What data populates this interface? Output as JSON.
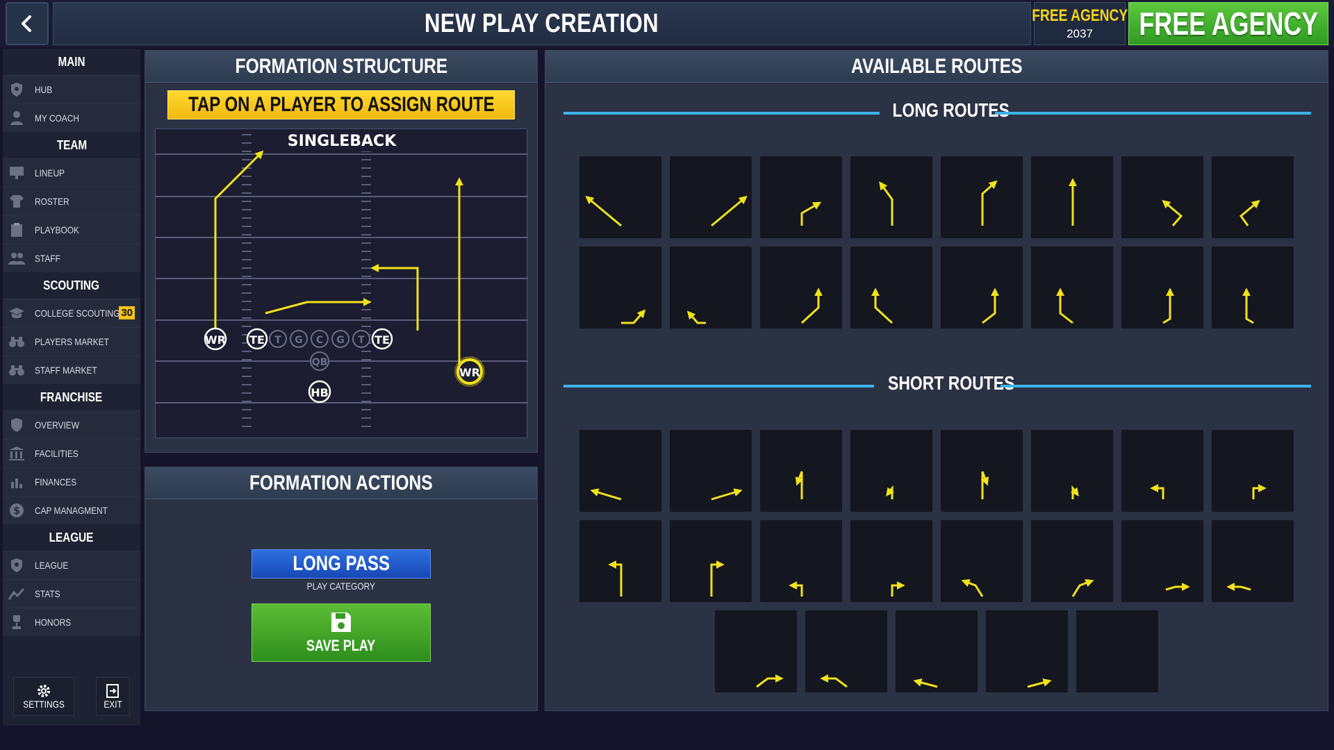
{
  "header": {
    "title": "NEW PLAY CREATION",
    "season_label": "FREE AGENCY",
    "season_year": "2037",
    "phase_button": "FREE AGENCY"
  },
  "sidebar": {
    "sections": [
      {
        "title": "MAIN",
        "items": [
          {
            "label": "HUB",
            "icon": "shield-icon"
          },
          {
            "label": "MY COACH",
            "icon": "person-icon"
          }
        ]
      },
      {
        "title": "TEAM",
        "items": [
          {
            "label": "LINEUP",
            "icon": "board-icon"
          },
          {
            "label": "ROSTER",
            "icon": "jersey-icon"
          },
          {
            "label": "PLAYBOOK",
            "icon": "clipboard-icon"
          },
          {
            "label": "STAFF",
            "icon": "people-icon"
          }
        ]
      },
      {
        "title": "SCOUTING",
        "items": [
          {
            "label": "COLLEGE SCOUTING",
            "icon": "graduation-cap-icon",
            "badge": "30"
          },
          {
            "label": "PLAYERS MARKET",
            "icon": "binoculars-icon"
          },
          {
            "label": "STAFF MARKET",
            "icon": "binoculars-icon"
          }
        ]
      },
      {
        "title": "FRANCHISE",
        "items": [
          {
            "label": "OVERVIEW",
            "icon": "shield-icon"
          },
          {
            "label": "FACILITIES",
            "icon": "building-icon"
          },
          {
            "label": "FINANCES",
            "icon": "bar-chart-icon"
          },
          {
            "label": "CAP MANAGMENT",
            "icon": "dollar-icon"
          }
        ]
      },
      {
        "title": "LEAGUE",
        "items": [
          {
            "label": "LEAGUE",
            "icon": "shield-icon"
          },
          {
            "label": "STATS",
            "icon": "chart-line-icon"
          },
          {
            "label": "HONORS",
            "icon": "trophy-icon"
          }
        ]
      }
    ],
    "settings_label": "SETTINGS",
    "exit_label": "EXIT"
  },
  "formation": {
    "panel_title": "FORMATION STRUCTURE",
    "banner": "TAP ON A PLAYER TO ASSIGN ROUTE",
    "formation_name": "SINGLEBACK",
    "players": [
      {
        "pos": "WR",
        "active": true,
        "selected": false
      },
      {
        "pos": "TE",
        "active": true,
        "selected": false
      },
      {
        "pos": "T",
        "active": false,
        "selected": false
      },
      {
        "pos": "G",
        "active": false,
        "selected": false
      },
      {
        "pos": "C",
        "active": false,
        "selected": false
      },
      {
        "pos": "G",
        "active": false,
        "selected": false
      },
      {
        "pos": "T",
        "active": false,
        "selected": false
      },
      {
        "pos": "TE",
        "active": true,
        "selected": false
      },
      {
        "pos": "QB",
        "active": false,
        "selected": false
      },
      {
        "pos": "HB",
        "active": true,
        "selected": false
      },
      {
        "pos": "WR",
        "active": true,
        "selected": true
      }
    ]
  },
  "actions": {
    "panel_title": "FORMATION ACTIONS",
    "play_category_value": "LONG PASS",
    "play_category_label": "PLAY CATEGORY",
    "save_label": "SAVE PLAY"
  },
  "routes": {
    "panel_title": "AVAILABLE ROUTES",
    "long_title": "LONG ROUTES",
    "short_title": "SHORT ROUTES",
    "route_color": "#f2e21a"
  },
  "colors": {
    "accent_green": "#3fae2a",
    "accent_yellow": "#f5d31a",
    "accent_blue": "#2f6fe0",
    "divider_blue": "#3fb3e8"
  }
}
